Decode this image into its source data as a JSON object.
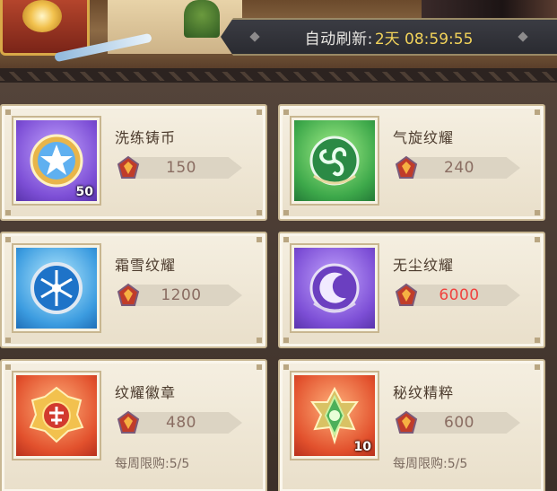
{
  "header": {
    "refresh_label": "自动刷新:",
    "refresh_time": "2天 08:59:55"
  },
  "currency_icon": "red-crystal-gem-icon",
  "items": [
    {
      "name": "洗练铸币",
      "price": "150",
      "quantity": "50",
      "icon": "star-coin-icon",
      "frame_color": "#7d4fd6"
    },
    {
      "name": "气旋纹耀",
      "price": "240",
      "icon": "triskelion-emblem-icon",
      "frame_color": "#3da84a"
    },
    {
      "name": "霜雪纹耀",
      "price": "1200",
      "icon": "snowflake-emblem-icon",
      "frame_color": "#3c9ce0"
    },
    {
      "name": "无尘纹耀",
      "price": "6000",
      "price_color": "#f0433f",
      "icon": "crescent-emblem-icon",
      "frame_color": "#7d4fd6"
    },
    {
      "name": "纹耀徽章",
      "price": "480",
      "limit": "每周限购:5/5",
      "icon": "gold-badge-icon",
      "frame_color": "#e2512d"
    },
    {
      "name": "秘纹精粹",
      "price": "600",
      "quantity": "10",
      "limit": "每周限购:5/5",
      "icon": "green-essence-icon",
      "frame_color": "#e2512d"
    }
  ]
}
